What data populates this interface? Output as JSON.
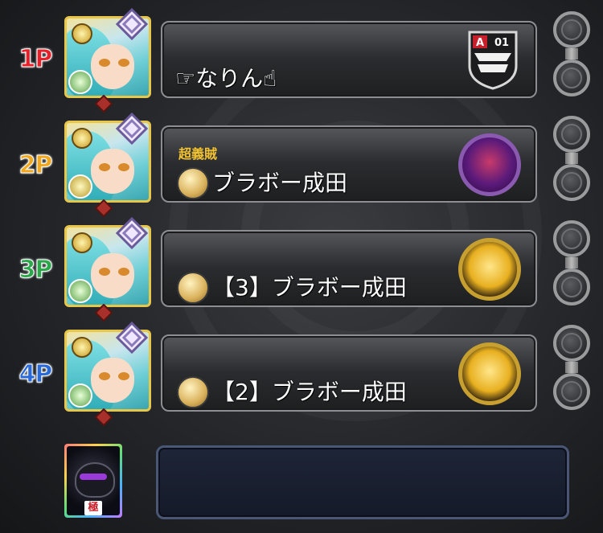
{
  "players": [
    {
      "label": "1P",
      "label_color": "#e8202a",
      "title": "",
      "name": "☞なりん☝",
      "has_rank_mark": false,
      "right_type": "emblem",
      "emblem_text": "01",
      "emblem_letter": "A"
    },
    {
      "label": "2P",
      "label_color": "#f2a81c",
      "title": "超義賊",
      "name": "ブラボー成田",
      "has_rank_mark": true,
      "right_type": "monster",
      "monster_color": "#7a2c9a"
    },
    {
      "label": "3P",
      "label_color": "#2aa84a",
      "title": "",
      "name": "【3】ブラボー成田",
      "has_rank_mark": true,
      "right_type": "monster",
      "monster_color": "#e8b020"
    },
    {
      "label": "4P",
      "label_color": "#2a6ad8",
      "title": "",
      "name": "【2】ブラボー成田",
      "has_rank_mark": true,
      "right_type": "monster",
      "monster_color": "#e8b020"
    }
  ],
  "icons": {
    "rank_mark": "gold-medal-icon",
    "side_orb": "empty-slot-orb-icon",
    "emblem": "shield-emblem-icon"
  },
  "helper_badge": "極"
}
